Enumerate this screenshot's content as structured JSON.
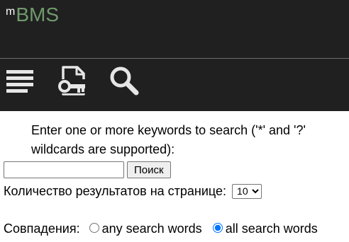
{
  "app": {
    "logo_prefix": "m",
    "logo_text": "BMS"
  },
  "toolbar": {
    "items": [
      {
        "icon": "menu-icon",
        "label": ""
      },
      {
        "icon": "document-key-icon",
        "label": ""
      },
      {
        "icon": "search-icon",
        "label": ""
      }
    ]
  },
  "search": {
    "intro": "Enter one or more keywords to search ('*' and '?' wildcards are supported):",
    "query_value": "",
    "button_label": "Поиск",
    "results_per_page_label": "Количество результатов на странице:",
    "results_per_page_value": "10",
    "match_label": "Совпадения:",
    "match_options": [
      {
        "label": "any search words",
        "selected": false
      },
      {
        "label": "all search words",
        "selected": true
      }
    ]
  },
  "colors": {
    "header_bg": "#202020",
    "logo_green": "#6f9a6b",
    "icon_color": "#e6e6e6"
  }
}
